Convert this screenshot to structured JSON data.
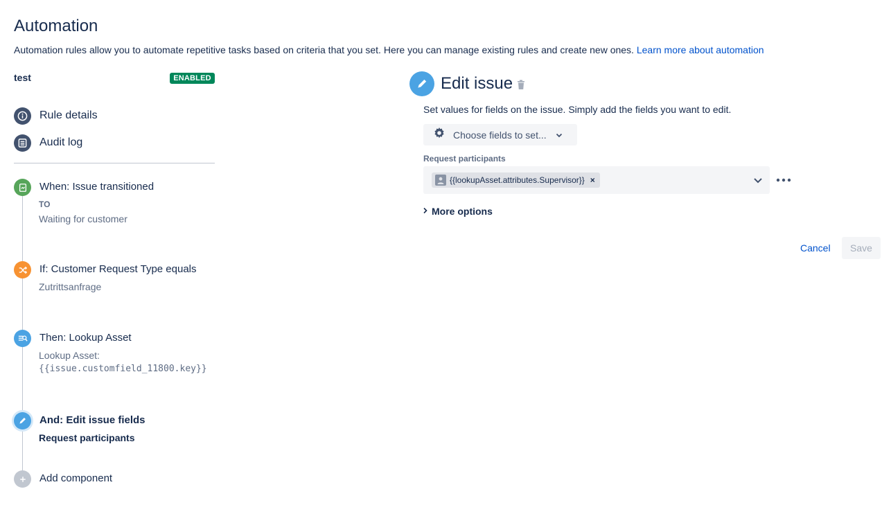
{
  "header": {
    "title": "Automation",
    "description": "Automation rules allow you to automate repetitive tasks based on criteria that you set. Here you can manage existing rules and create new ones.",
    "learn_more_link": "Learn more about automation"
  },
  "rule": {
    "name": "test",
    "status": "ENABLED"
  },
  "nav": {
    "rule_details": "Rule details",
    "audit_log": "Audit log"
  },
  "steps": [
    {
      "title": "When: Issue transitioned",
      "sub1": "TO",
      "sub2": "Waiting for customer",
      "color": "#57a55a",
      "icon": "trigger-icon"
    },
    {
      "title": "If: Customer Request Type equals",
      "sub1": "Zutrittsanfrage",
      "color": "#f79232",
      "icon": "shuffle-icon"
    },
    {
      "title": "Then: Lookup Asset",
      "sub1": "Lookup Asset:",
      "sub2": "{{issue.customfield_11800.key}}",
      "color": "#4ba3e3",
      "icon": "lookup-icon"
    },
    {
      "title": "And: Edit issue fields",
      "sub1": "Request participants",
      "color": "#4ba3e3",
      "icon": "pencil-icon"
    },
    {
      "title": "Add component",
      "color": "#c1c7d0",
      "icon": "plus-icon"
    }
  ],
  "editor": {
    "title": "Edit issue",
    "description": "Set values for fields on the issue. Simply add the fields you want to edit.",
    "choose_fields": "Choose fields to set...",
    "field_label": "Request participants",
    "field_value": "{{lookupAsset.attributes.Supervisor}}",
    "tag_remove": "×",
    "more_options": "More options",
    "cancel": "Cancel",
    "save": "Save"
  },
  "colors": {
    "link": "#0052cc",
    "enabled": "#00875a",
    "nav_icon": "#42526e",
    "text": "#172b4d",
    "subtle": "#5e6c84"
  }
}
